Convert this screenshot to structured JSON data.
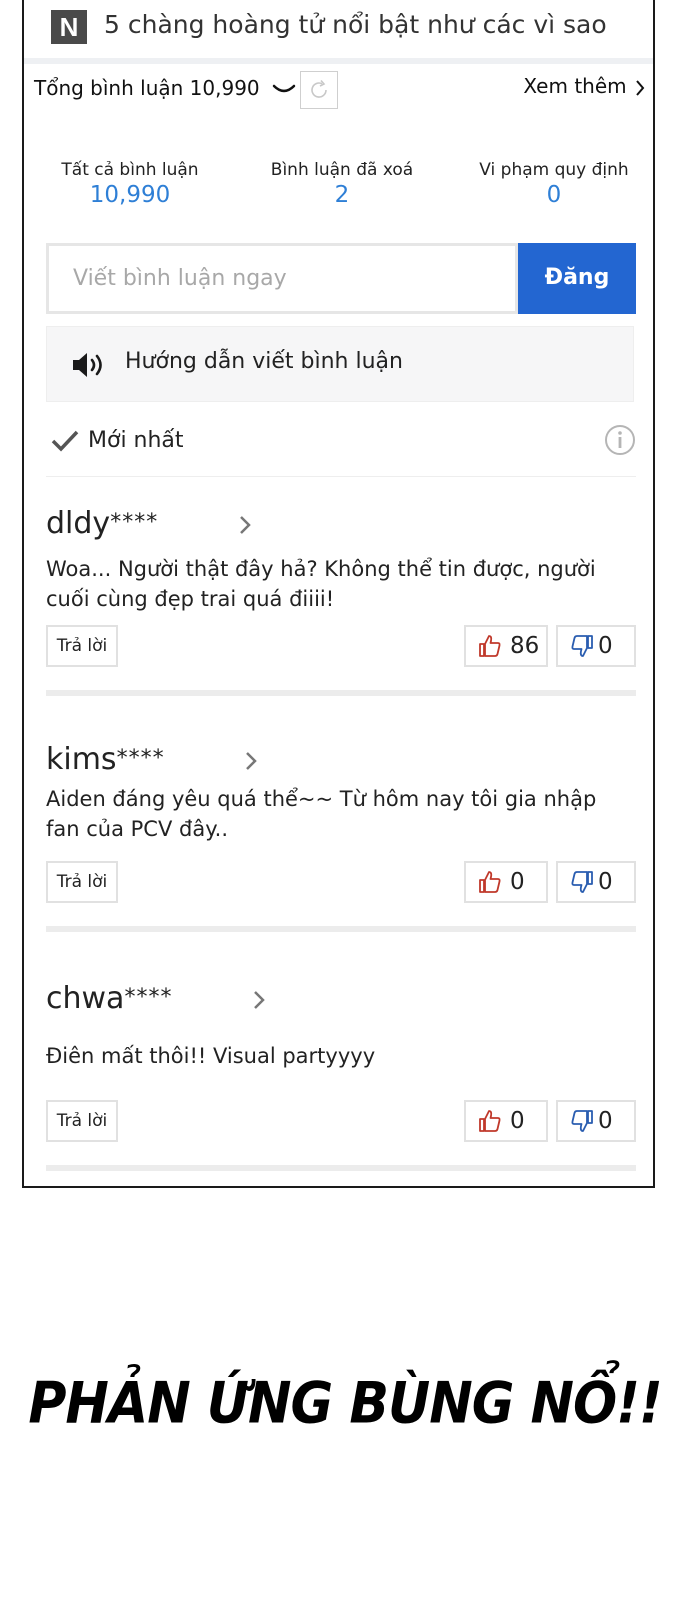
{
  "header": {
    "logo_letter": "N",
    "article_title": "5 chàng hoàng tử nổi bật như các vì sao"
  },
  "toolbar": {
    "total_label": "Tổng bình luận 10,990",
    "see_more": "Xem thêm"
  },
  "stats": [
    {
      "label": "Tất cả bình luận",
      "value": "10,990"
    },
    {
      "label": "Bình luận đã xoá",
      "value": "2"
    },
    {
      "label": "Vi phạm quy định",
      "value": "0"
    }
  ],
  "write": {
    "placeholder": "Viết bình luận ngay",
    "post_label": "Đăng"
  },
  "guide": {
    "label": "Hướng dẫn viết bình luận"
  },
  "sort": {
    "label": "Mới nhất"
  },
  "comments": [
    {
      "user": "dldy",
      "mask": "****",
      "text": "Woa... Người thật đây hả? Không thể tin được, người cuối cùng đẹp trai quá điiii!",
      "reply": "Trả lời",
      "likes": "86",
      "dislikes": "0"
    },
    {
      "user": "kims",
      "mask": "****",
      "text": "Aiden đáng yêu quá thể~~ Từ hôm nay tôi gia nhập fan của PCV đây..",
      "reply": "Trả lời",
      "likes": "0",
      "dislikes": "0"
    },
    {
      "user": "chwa",
      "mask": "****",
      "text": "Điên mất thôi!! Visual partyyyy",
      "reply": "Trả lời",
      "likes": "0",
      "dislikes": "0"
    }
  ],
  "caption": "PHẢN ỨNG BÙNG NỔ!!",
  "colors": {
    "accent_blue": "#2366d1",
    "stat_blue": "#2e7fd6",
    "like_red": "#c0392b",
    "dislike_blue": "#2a5db0"
  },
  "icons": [
    "n-logo-icon",
    "chevron-down-icon",
    "refresh-icon",
    "chevron-right-icon",
    "speaker-icon",
    "check-icon",
    "info-icon",
    "thumbs-up-icon",
    "thumbs-down-icon"
  ]
}
